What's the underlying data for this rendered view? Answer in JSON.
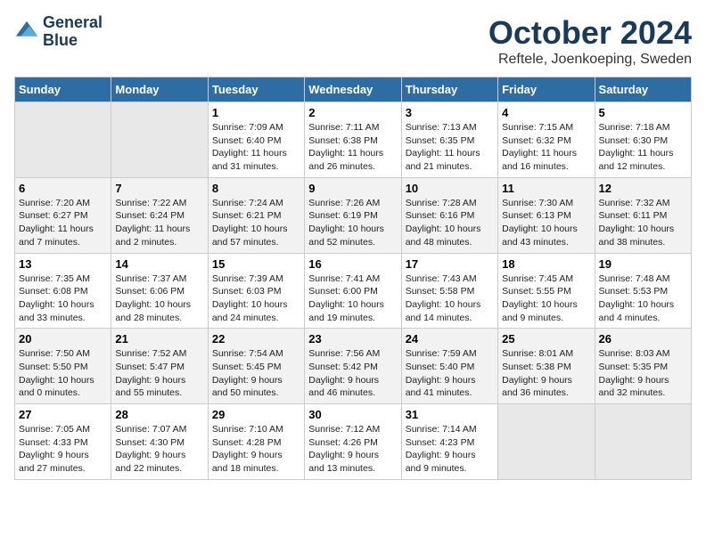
{
  "logo": {
    "line1": "General",
    "line2": "Blue"
  },
  "title": "October 2024",
  "location": "Reftele, Joenkoeping, Sweden",
  "days_of_week": [
    "Sunday",
    "Monday",
    "Tuesday",
    "Wednesday",
    "Thursday",
    "Friday",
    "Saturday"
  ],
  "weeks": [
    [
      {
        "day": "",
        "info": ""
      },
      {
        "day": "",
        "info": ""
      },
      {
        "day": "1",
        "info": "Sunrise: 7:09 AM\nSunset: 6:40 PM\nDaylight: 11 hours\nand 31 minutes."
      },
      {
        "day": "2",
        "info": "Sunrise: 7:11 AM\nSunset: 6:38 PM\nDaylight: 11 hours\nand 26 minutes."
      },
      {
        "day": "3",
        "info": "Sunrise: 7:13 AM\nSunset: 6:35 PM\nDaylight: 11 hours\nand 21 minutes."
      },
      {
        "day": "4",
        "info": "Sunrise: 7:15 AM\nSunset: 6:32 PM\nDaylight: 11 hours\nand 16 minutes."
      },
      {
        "day": "5",
        "info": "Sunrise: 7:18 AM\nSunset: 6:30 PM\nDaylight: 11 hours\nand 12 minutes."
      }
    ],
    [
      {
        "day": "6",
        "info": "Sunrise: 7:20 AM\nSunset: 6:27 PM\nDaylight: 11 hours\nand 7 minutes."
      },
      {
        "day": "7",
        "info": "Sunrise: 7:22 AM\nSunset: 6:24 PM\nDaylight: 11 hours\nand 2 minutes."
      },
      {
        "day": "8",
        "info": "Sunrise: 7:24 AM\nSunset: 6:21 PM\nDaylight: 10 hours\nand 57 minutes."
      },
      {
        "day": "9",
        "info": "Sunrise: 7:26 AM\nSunset: 6:19 PM\nDaylight: 10 hours\nand 52 minutes."
      },
      {
        "day": "10",
        "info": "Sunrise: 7:28 AM\nSunset: 6:16 PM\nDaylight: 10 hours\nand 48 minutes."
      },
      {
        "day": "11",
        "info": "Sunrise: 7:30 AM\nSunset: 6:13 PM\nDaylight: 10 hours\nand 43 minutes."
      },
      {
        "day": "12",
        "info": "Sunrise: 7:32 AM\nSunset: 6:11 PM\nDaylight: 10 hours\nand 38 minutes."
      }
    ],
    [
      {
        "day": "13",
        "info": "Sunrise: 7:35 AM\nSunset: 6:08 PM\nDaylight: 10 hours\nand 33 minutes."
      },
      {
        "day": "14",
        "info": "Sunrise: 7:37 AM\nSunset: 6:06 PM\nDaylight: 10 hours\nand 28 minutes."
      },
      {
        "day": "15",
        "info": "Sunrise: 7:39 AM\nSunset: 6:03 PM\nDaylight: 10 hours\nand 24 minutes."
      },
      {
        "day": "16",
        "info": "Sunrise: 7:41 AM\nSunset: 6:00 PM\nDaylight: 10 hours\nand 19 minutes."
      },
      {
        "day": "17",
        "info": "Sunrise: 7:43 AM\nSunset: 5:58 PM\nDaylight: 10 hours\nand 14 minutes."
      },
      {
        "day": "18",
        "info": "Sunrise: 7:45 AM\nSunset: 5:55 PM\nDaylight: 10 hours\nand 9 minutes."
      },
      {
        "day": "19",
        "info": "Sunrise: 7:48 AM\nSunset: 5:53 PM\nDaylight: 10 hours\nand 4 minutes."
      }
    ],
    [
      {
        "day": "20",
        "info": "Sunrise: 7:50 AM\nSunset: 5:50 PM\nDaylight: 10 hours\nand 0 minutes."
      },
      {
        "day": "21",
        "info": "Sunrise: 7:52 AM\nSunset: 5:47 PM\nDaylight: 9 hours\nand 55 minutes."
      },
      {
        "day": "22",
        "info": "Sunrise: 7:54 AM\nSunset: 5:45 PM\nDaylight: 9 hours\nand 50 minutes."
      },
      {
        "day": "23",
        "info": "Sunrise: 7:56 AM\nSunset: 5:42 PM\nDaylight: 9 hours\nand 46 minutes."
      },
      {
        "day": "24",
        "info": "Sunrise: 7:59 AM\nSunset: 5:40 PM\nDaylight: 9 hours\nand 41 minutes."
      },
      {
        "day": "25",
        "info": "Sunrise: 8:01 AM\nSunset: 5:38 PM\nDaylight: 9 hours\nand 36 minutes."
      },
      {
        "day": "26",
        "info": "Sunrise: 8:03 AM\nSunset: 5:35 PM\nDaylight: 9 hours\nand 32 minutes."
      }
    ],
    [
      {
        "day": "27",
        "info": "Sunrise: 7:05 AM\nSunset: 4:33 PM\nDaylight: 9 hours\nand 27 minutes."
      },
      {
        "day": "28",
        "info": "Sunrise: 7:07 AM\nSunset: 4:30 PM\nDaylight: 9 hours\nand 22 minutes."
      },
      {
        "day": "29",
        "info": "Sunrise: 7:10 AM\nSunset: 4:28 PM\nDaylight: 9 hours\nand 18 minutes."
      },
      {
        "day": "30",
        "info": "Sunrise: 7:12 AM\nSunset: 4:26 PM\nDaylight: 9 hours\nand 13 minutes."
      },
      {
        "day": "31",
        "info": "Sunrise: 7:14 AM\nSunset: 4:23 PM\nDaylight: 9 hours\nand 9 minutes."
      },
      {
        "day": "",
        "info": ""
      },
      {
        "day": "",
        "info": ""
      }
    ]
  ]
}
